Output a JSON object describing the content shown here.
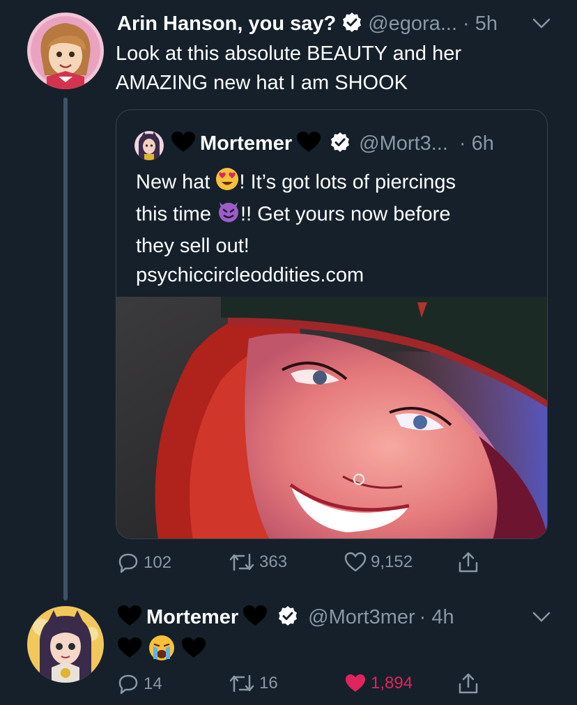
{
  "tweet1": {
    "name": "Arin Hanson, you say?",
    "handle": "@egora...",
    "time": "· 5h",
    "text_line1": "Look at this absolute BEAUTY and her",
    "text_line2": "AMAZING new hat I am SHOOK",
    "actions": {
      "replies": "102",
      "retweets": "363",
      "likes": "9,152"
    }
  },
  "quote": {
    "name": "Mortemer",
    "handle": "@Mort3...",
    "time": "· 6h",
    "text1a": "New hat ",
    "text1b": "! It’s got lots of piercings",
    "text2a": "this time ",
    "text2b": "!! Get yours now before",
    "text3": "they sell out!",
    "link": "psychiccircleoddities.com"
  },
  "tweet2": {
    "name": "Mortemer",
    "handle": "@Mort3mer",
    "time": "· 4h",
    "actions": {
      "replies": "14",
      "retweets": "16",
      "likes": "1,894"
    }
  },
  "colors": {
    "background": "#15202b",
    "secondary_text": "#8899a6",
    "like_red": "#e0245e",
    "verified_bg": "#ffffff"
  },
  "icons": [
    "verified-badge-icon",
    "chevron-down-icon",
    "reply-icon",
    "retweet-icon",
    "like-icon",
    "share-icon",
    "black-heart-icon",
    "heart-eyes-emoji",
    "smiling-imp-emoji",
    "crying-face-emoji"
  ]
}
